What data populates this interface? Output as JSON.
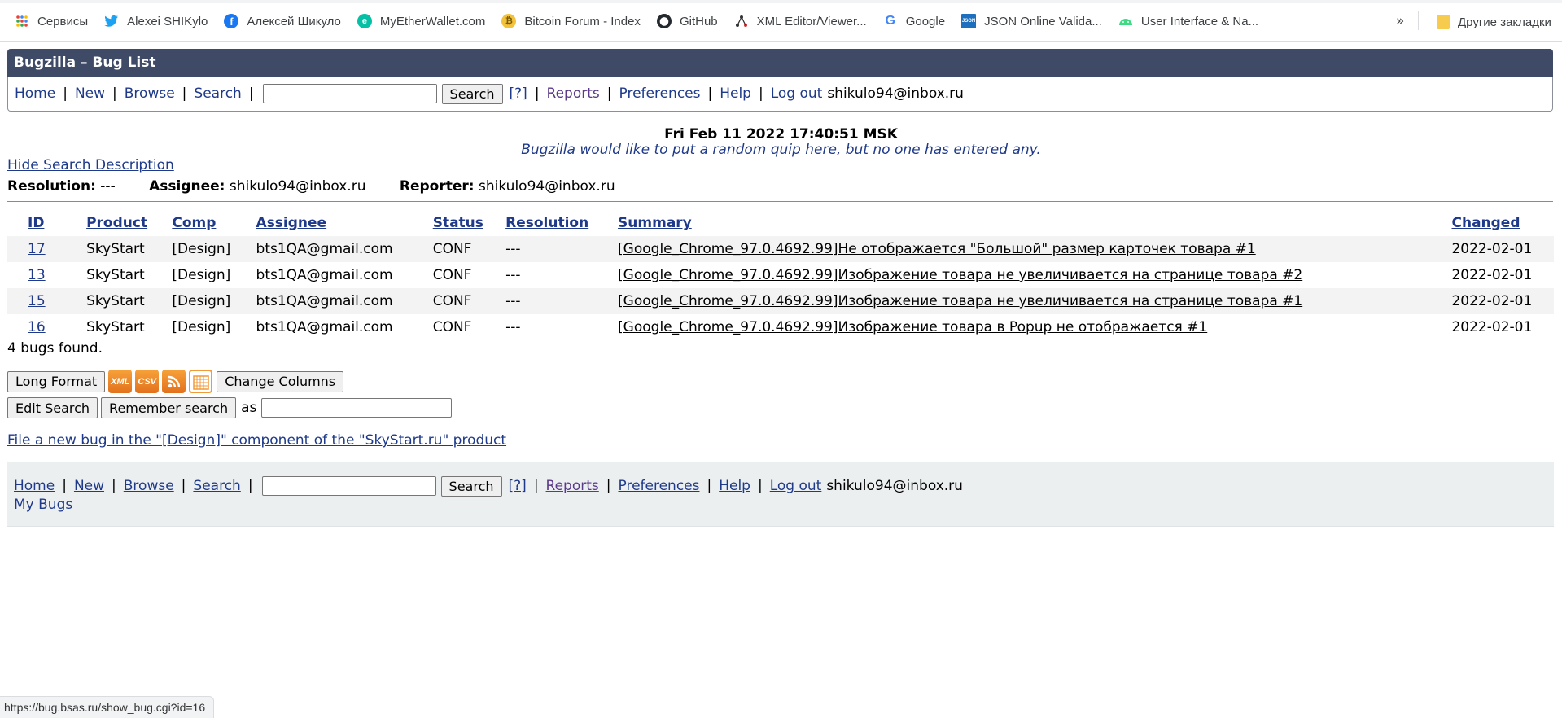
{
  "bookmarks": {
    "items": [
      {
        "label": "Сервисы",
        "icon": "apps-grid-icon"
      },
      {
        "label": "Alexei SHIKylo",
        "icon": "twitter-icon"
      },
      {
        "label": "Алексей Шикуло",
        "icon": "facebook-icon"
      },
      {
        "label": "MyEtherWallet.com",
        "icon": "myetherwallet-icon"
      },
      {
        "label": "Bitcoin Forum - Index",
        "icon": "bitcoin-icon"
      },
      {
        "label": "GitHub",
        "icon": "github-icon"
      },
      {
        "label": "XML Editor/Viewer...",
        "icon": "xml-tree-icon"
      },
      {
        "label": "Google",
        "icon": "google-icon"
      },
      {
        "label": "JSON Online Valida...",
        "icon": "json-icon"
      },
      {
        "label": "User Interface & Na...",
        "icon": "android-icon"
      }
    ],
    "more": "»",
    "other": "Другие закладки"
  },
  "header": {
    "title": "Bugzilla – Bug List",
    "links": {
      "home": "Home",
      "new": "New",
      "browse": "Browse",
      "search": "Search",
      "help_q": "[?]",
      "reports": "Reports",
      "preferences": "Preferences",
      "help": "Help",
      "logout": "Log out"
    },
    "search_button": "Search",
    "user": "shikulo94@inbox.ru"
  },
  "date_line": "Fri Feb 11 2022 17:40:51 MSK",
  "quip": "Bugzilla would like to put a random quip here, but no one has entered any.",
  "hide_search_description": "Hide Search Description",
  "search_description": {
    "resolution_label": "Resolution:",
    "resolution_value": "---",
    "assignee_label": "Assignee:",
    "assignee_value": "shikulo94@inbox.ru",
    "reporter_label": "Reporter:",
    "reporter_value": "shikulo94@inbox.ru"
  },
  "table": {
    "columns": [
      "ID",
      "Product",
      "Comp",
      "Assignee",
      "Status",
      "Resolution",
      "Summary",
      "Changed"
    ],
    "rows": [
      {
        "id": "17",
        "product": "SkyStart",
        "comp": "[Design]",
        "assignee": "bts1QA@gmail.com",
        "status": "CONF",
        "resolution": "---",
        "summary": "[Google_Chrome_97.0.4692.99]Не отображается \"Большой\" размер карточек товара #1",
        "changed": "2022-02-01"
      },
      {
        "id": "13",
        "product": "SkyStart",
        "comp": "[Design]",
        "assignee": "bts1QA@gmail.com",
        "status": "CONF",
        "resolution": "---",
        "summary": "[Google_Chrome_97.0.4692.99]Изображение товара не увеличивается на странице товара #2",
        "changed": "2022-02-01"
      },
      {
        "id": "15",
        "product": "SkyStart",
        "comp": "[Design]",
        "assignee": "bts1QA@gmail.com",
        "status": "CONF",
        "resolution": "---",
        "summary": "[Google_Chrome_97.0.4692.99]Изображение товара не увеличивается на странице товара #1",
        "changed": "2022-02-01"
      },
      {
        "id": "16",
        "product": "SkyStart",
        "comp": "[Design]",
        "assignee": "bts1QA@gmail.com",
        "status": "CONF",
        "resolution": "---",
        "summary": "[Google_Chrome_97.0.4692.99]Изображение товара в Popup не отображается #1",
        "changed": "2022-02-01"
      }
    ]
  },
  "bugs_found": "4 bugs found.",
  "actions": {
    "long_format": "Long Format",
    "format_icons": [
      {
        "label": "XML",
        "icon": "xml-feed-icon"
      },
      {
        "label": "CSV",
        "icon": "csv-icon"
      },
      {
        "label": "",
        "icon": "rss-feed-icon"
      },
      {
        "label": "",
        "icon": "ical-calendar-icon"
      }
    ],
    "change_columns": "Change Columns",
    "edit_search": "Edit Search",
    "remember_search": "Remember search",
    "as_label": "as"
  },
  "file_new_bug": "File a new bug in the \"[Design]\" component of the \"SkyStart.ru\" product",
  "footer": {
    "my_bugs": "My Bugs"
  },
  "status_url": "https://bug.bsas.ru/show_bug.cgi?id=16"
}
